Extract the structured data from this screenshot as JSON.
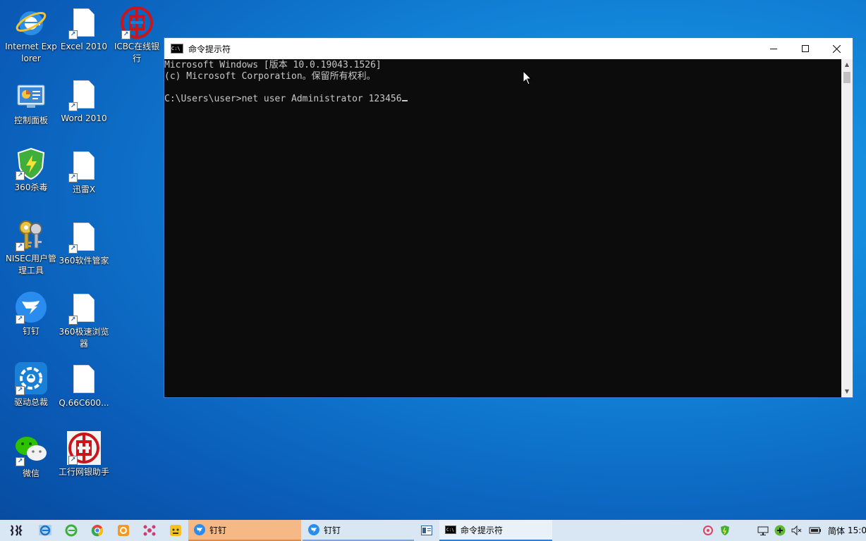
{
  "desktop": {
    "icons": [
      {
        "name": "internet-explorer",
        "label": "Internet Explorer"
      },
      {
        "name": "excel-2010",
        "label": "Excel 2010"
      },
      {
        "name": "icbc-online",
        "label": "ICBC在线银行"
      },
      {
        "name": "control-panel",
        "label": "控制面板"
      },
      {
        "name": "word-2010",
        "label": "Word 2010"
      },
      {
        "name": "360-antivirus",
        "label": "360杀毒"
      },
      {
        "name": "xunlei-x",
        "label": "迅雷X"
      },
      {
        "name": "nisec-tool",
        "label": "NISEC用户管理工具"
      },
      {
        "name": "360-software-manager",
        "label": "360软件管家"
      },
      {
        "name": "dingtalk",
        "label": "钉钉"
      },
      {
        "name": "360-browser",
        "label": "360极速浏览器"
      },
      {
        "name": "driver-manager",
        "label": "驱动总裁"
      },
      {
        "name": "qq-file",
        "label": "Q.66C600..."
      },
      {
        "name": "wechat",
        "label": "微信"
      },
      {
        "name": "icbc-assistant",
        "label": "工行网银助手"
      }
    ]
  },
  "cmd_window": {
    "title": "命令提示符",
    "lines": [
      "Microsoft Windows [版本 10.0.19043.1526]",
      "(c) Microsoft Corporation。保留所有权利。",
      "",
      "C:\\Users\\user>net user Administrator 123456"
    ],
    "controls": {
      "minimize": "minimize-icon",
      "maximize": "maximize-icon",
      "close": "close-icon"
    }
  },
  "taskbar": {
    "buttons": [
      {
        "label": "钉钉",
        "state": "highlighted"
      },
      {
        "label": "钉钉",
        "state": "normal"
      },
      {
        "label": "命令提示符",
        "state": "active"
      }
    ],
    "tray": {
      "ime_label": "简体",
      "clock": "15:0"
    }
  },
  "colors": {
    "taskbar_bg": "#d9e6f3",
    "highlight_btn": "#f6b884",
    "console_bg": "#0c0c0c",
    "console_fg": "#c8c8c8",
    "accent": "#3c7bd1"
  }
}
